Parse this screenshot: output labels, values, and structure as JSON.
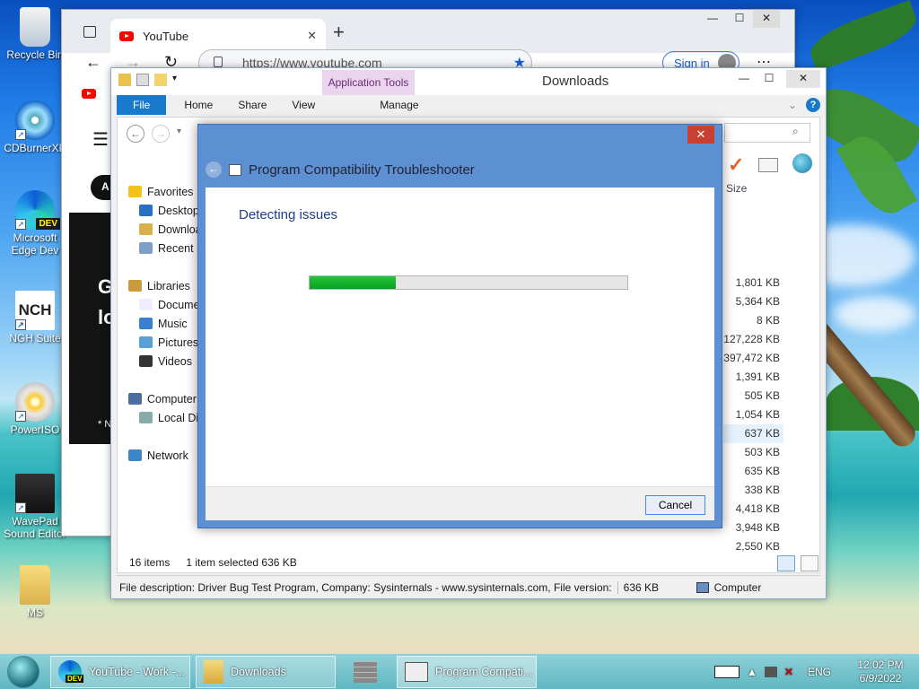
{
  "desktop": {
    "icons": [
      {
        "label": "Recycle Bin",
        "icon": "recycle-bin-icon"
      },
      {
        "label": "CDBurnerXP",
        "icon": "cd-burner-icon"
      },
      {
        "label": "Microsoft Edge Dev",
        "icon": "edge-dev-icon",
        "badge": "DEV"
      },
      {
        "label": "NGH Suite",
        "icon": "nch-suite-icon",
        "logo": "NCH"
      },
      {
        "label": "PowerISO",
        "icon": "poweriso-icon"
      },
      {
        "label": "WavePad Sound Editor",
        "icon": "wavepad-icon"
      },
      {
        "label": "MS",
        "icon": "folder-icon"
      }
    ]
  },
  "browser": {
    "tab_title": "YouTube",
    "tab_close": "✕",
    "new_tab": "+",
    "url": "https://www.youtube.com",
    "sign_in": "Sign in",
    "page_letters": {
      "a": "A",
      "g": "G",
      "lo": "lo",
      "note": "* N"
    }
  },
  "explorer": {
    "title": "Downloads",
    "app_tools": "Application Tools",
    "tabs": {
      "file": "File",
      "home": "Home",
      "share": "Share",
      "view": "View",
      "manage": "Manage"
    },
    "column_size": "Size",
    "tree": [
      {
        "label": "Favorites",
        "icon": "star-icon",
        "indent": 0
      },
      {
        "label": "Desktop",
        "icon": "desktop-icon",
        "indent": 1
      },
      {
        "label": "Downloads",
        "icon": "downloads-icon",
        "indent": 1
      },
      {
        "label": "Recent places",
        "icon": "recent-icon",
        "indent": 1
      },
      {
        "label": "",
        "icon": "",
        "indent": 0
      },
      {
        "label": "Libraries",
        "icon": "libraries-icon",
        "indent": 0
      },
      {
        "label": "Documents",
        "icon": "documents-icon",
        "indent": 1
      },
      {
        "label": "Music",
        "icon": "music-icon",
        "indent": 1
      },
      {
        "label": "Pictures",
        "icon": "pictures-icon",
        "indent": 1
      },
      {
        "label": "Videos",
        "icon": "videos-icon",
        "indent": 1
      },
      {
        "label": "",
        "icon": "",
        "indent": 0
      },
      {
        "label": "Computer",
        "icon": "computer-icon",
        "indent": 0
      },
      {
        "label": "Local Disk",
        "icon": "disk-icon",
        "indent": 1
      },
      {
        "label": "",
        "icon": "",
        "indent": 0
      },
      {
        "label": "Network",
        "icon": "network-icon",
        "indent": 0
      }
    ],
    "sizes": [
      "1,801 KB",
      "5,364 KB",
      "8 KB",
      "127,228 KB",
      "397,472 KB",
      "1,391 KB",
      "505 KB",
      "1,054 KB",
      "637 KB",
      "503 KB",
      "635 KB",
      "338 KB",
      "4,418 KB",
      "3,948 KB",
      "2,550 KB"
    ],
    "selected_index": 8,
    "status_items": "16 items",
    "status_selected": "1 item selected  636 KB",
    "file_description": "File description: Driver Bug Test Program, Company: Sysinternals - www.sysinternals.com, File version:",
    "file_size": "636 KB",
    "location": "Computer"
  },
  "dialog": {
    "title": "Program Compatibility Troubleshooter",
    "close": "✕",
    "status": "Detecting issues",
    "progress": 0.27,
    "cancel": "Cancel"
  },
  "taskbar": {
    "buttons": [
      {
        "label": "YouTube - Work -...",
        "icon": "edge-dev-icon",
        "badge": "DEV"
      },
      {
        "label": "Downloads",
        "icon": "folder-icon"
      },
      {
        "label": "",
        "icon": "firewall-icon"
      },
      {
        "label": "Program Compati...",
        "icon": "troubleshooter-icon"
      }
    ],
    "lang": "ENG",
    "time": "12:02 PM",
    "date": "6/9/2022"
  },
  "colors": {
    "accent": "#1979ca",
    "dialog_frame": "#5d8fd3",
    "progress": "#06a31f"
  }
}
